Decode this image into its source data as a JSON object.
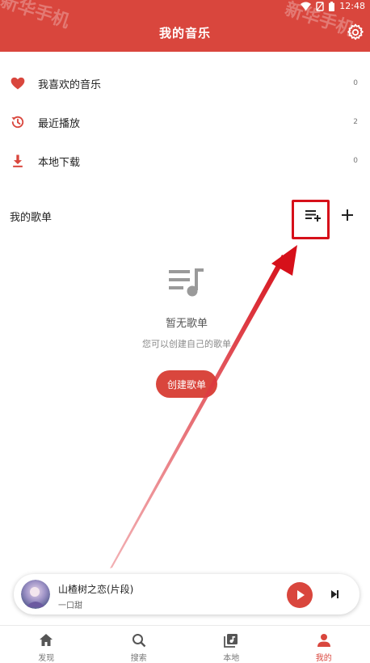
{
  "status_bar": {
    "time": "12:48"
  },
  "header": {
    "title": "我的音乐",
    "settings_icon": "gear-icon",
    "watermark": "新华手机"
  },
  "menu": [
    {
      "label": "我喜欢的音乐",
      "count": "0",
      "icon": "heart-icon"
    },
    {
      "label": "最近播放",
      "count": "2",
      "icon": "history-icon"
    },
    {
      "label": "本地下载",
      "count": "0",
      "icon": "download-icon"
    }
  ],
  "playlists": {
    "title": "我的歌单",
    "empty_title": "暂无歌单",
    "empty_subtitle": "您可以创建自己的歌单",
    "create_label": "创建歌单"
  },
  "player": {
    "song": "山楂树之恋(片段)",
    "artist": "一口甜"
  },
  "nav": [
    {
      "label": "发现",
      "icon": "home-icon",
      "active": false
    },
    {
      "label": "搜索",
      "icon": "search-icon",
      "active": false
    },
    {
      "label": "本地",
      "icon": "music-library-icon",
      "active": false
    },
    {
      "label": "我的",
      "icon": "person-icon",
      "active": true
    }
  ],
  "colors": {
    "accent": "#d9463d",
    "annotation": "#d6101a"
  }
}
